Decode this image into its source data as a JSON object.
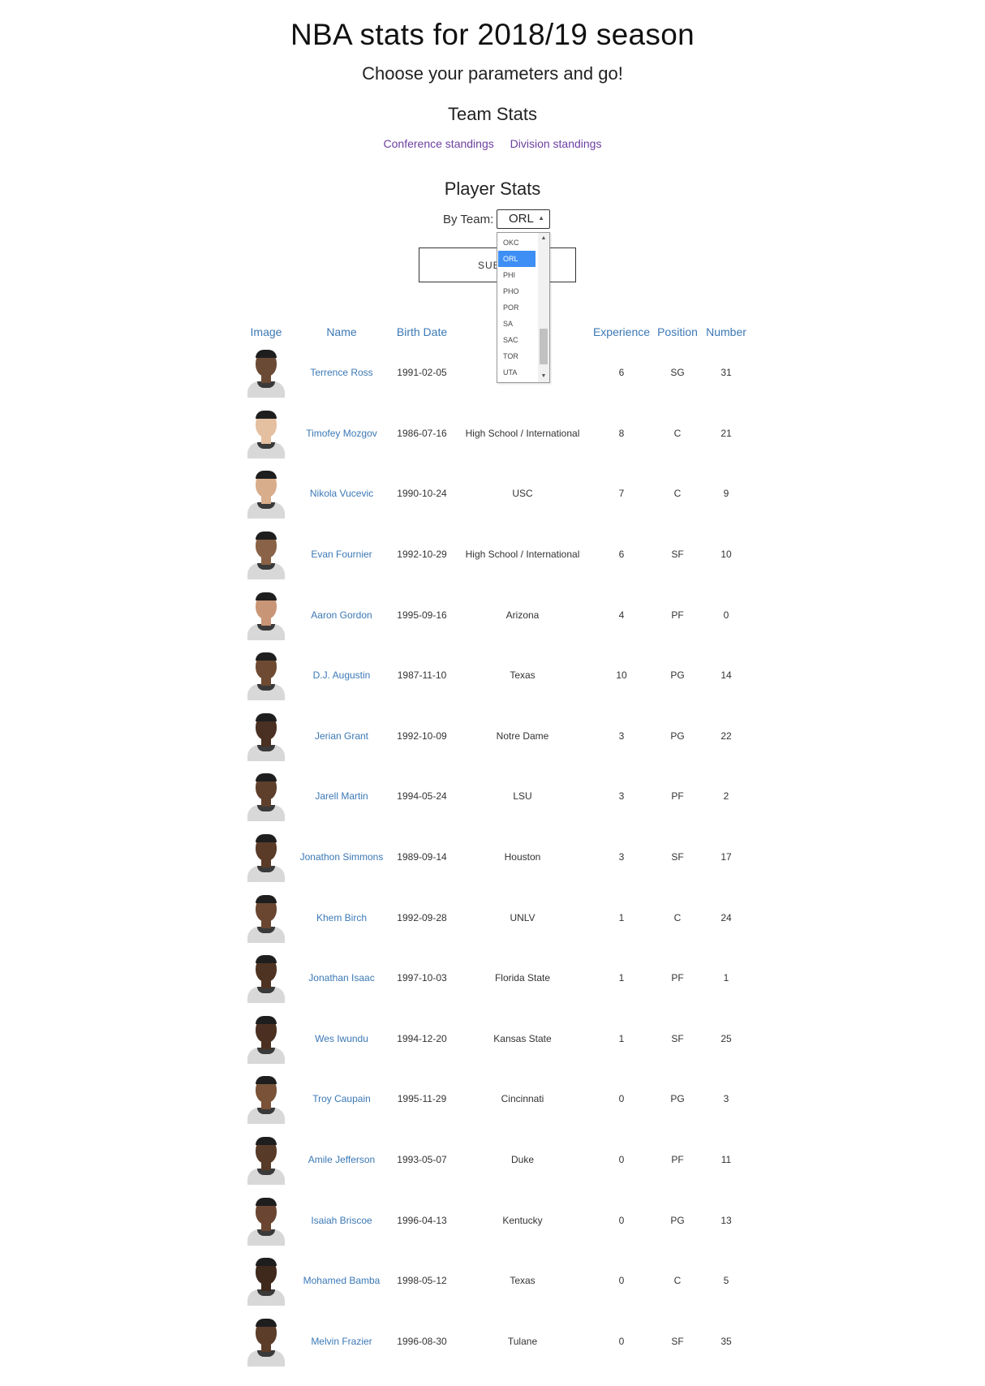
{
  "header": {
    "title": "NBA stats for 2018/19 season",
    "subtitle": "Choose your parameters and go!"
  },
  "team_stats": {
    "heading": "Team Stats",
    "links": [
      "Conference standings",
      "Division standings"
    ]
  },
  "player_stats": {
    "heading": "Player Stats",
    "by_team_label": "By Team:",
    "selected_team": "ORL",
    "submit_label": "SUE",
    "dropdown_options": [
      "OKC",
      "ORL",
      "PHI",
      "PHO",
      "POR",
      "SA",
      "SAC",
      "TOR",
      "UTA"
    ],
    "dropdown_selected_index": 1
  },
  "table": {
    "columns": [
      "Image",
      "Name",
      "Birth Date",
      "",
      "Experience",
      "Position",
      "Number"
    ],
    "rows": [
      {
        "name": "Terrence Ross",
        "birth": "1991-02-05",
        "college": "Y",
        "exp": "6",
        "pos": "SG",
        "num": "31",
        "skin": "#6b4a35"
      },
      {
        "name": "Timofey Mozgov",
        "birth": "1986-07-16",
        "college": "High School / International",
        "exp": "8",
        "pos": "C",
        "num": "21",
        "skin": "#e4bfa0"
      },
      {
        "name": "Nikola Vucevic",
        "birth": "1990-10-24",
        "college": "USC",
        "exp": "7",
        "pos": "C",
        "num": "9",
        "skin": "#d8ad8c"
      },
      {
        "name": "Evan Fournier",
        "birth": "1992-10-29",
        "college": "High School / International",
        "exp": "6",
        "pos": "SF",
        "num": "10",
        "skin": "#8a6247"
      },
      {
        "name": "Aaron Gordon",
        "birth": "1995-09-16",
        "college": "Arizona",
        "exp": "4",
        "pos": "PF",
        "num": "0",
        "skin": "#c89576"
      },
      {
        "name": "D.J. Augustin",
        "birth": "1987-11-10",
        "college": "Texas",
        "exp": "10",
        "pos": "PG",
        "num": "14",
        "skin": "#6e4a33"
      },
      {
        "name": "Jerian Grant",
        "birth": "1992-10-09",
        "college": "Notre Dame",
        "exp": "3",
        "pos": "PG",
        "num": "22",
        "skin": "#4a3022"
      },
      {
        "name": "Jarell Martin",
        "birth": "1994-05-24",
        "college": "LSU",
        "exp": "3",
        "pos": "PF",
        "num": "2",
        "skin": "#5e3f2c"
      },
      {
        "name": "Jonathon Simmons",
        "birth": "1989-09-14",
        "college": "Houston",
        "exp": "3",
        "pos": "SF",
        "num": "17",
        "skin": "#5a3b28"
      },
      {
        "name": "Khem Birch",
        "birth": "1992-09-28",
        "college": "UNLV",
        "exp": "1",
        "pos": "C",
        "num": "24",
        "skin": "#6a4631"
      },
      {
        "name": "Jonathan Isaac",
        "birth": "1997-10-03",
        "college": "Florida State",
        "exp": "1",
        "pos": "PF",
        "num": "1",
        "skin": "#4f3322"
      },
      {
        "name": "Wes Iwundu",
        "birth": "1994-12-20",
        "college": "Kansas State",
        "exp": "1",
        "pos": "SF",
        "num": "25",
        "skin": "#4b3021"
      },
      {
        "name": "Troy Caupain",
        "birth": "1995-11-29",
        "college": "Cincinnati",
        "exp": "0",
        "pos": "PG",
        "num": "3",
        "skin": "#7a5238"
      },
      {
        "name": "Amile Jefferson",
        "birth": "1993-05-07",
        "college": "Duke",
        "exp": "0",
        "pos": "PF",
        "num": "11",
        "skin": "#573a28"
      },
      {
        "name": "Isaiah Briscoe",
        "birth": "1996-04-13",
        "college": "Kentucky",
        "exp": "0",
        "pos": "PG",
        "num": "13",
        "skin": "#6a4632"
      },
      {
        "name": "Mohamed Bamba",
        "birth": "1998-05-12",
        "college": "Texas",
        "exp": "0",
        "pos": "C",
        "num": "5",
        "skin": "#3f281c"
      },
      {
        "name": "Melvin Frazier",
        "birth": "1996-08-30",
        "college": "Tulane",
        "exp": "0",
        "pos": "SF",
        "num": "35",
        "skin": "#5c3d2a"
      }
    ]
  }
}
